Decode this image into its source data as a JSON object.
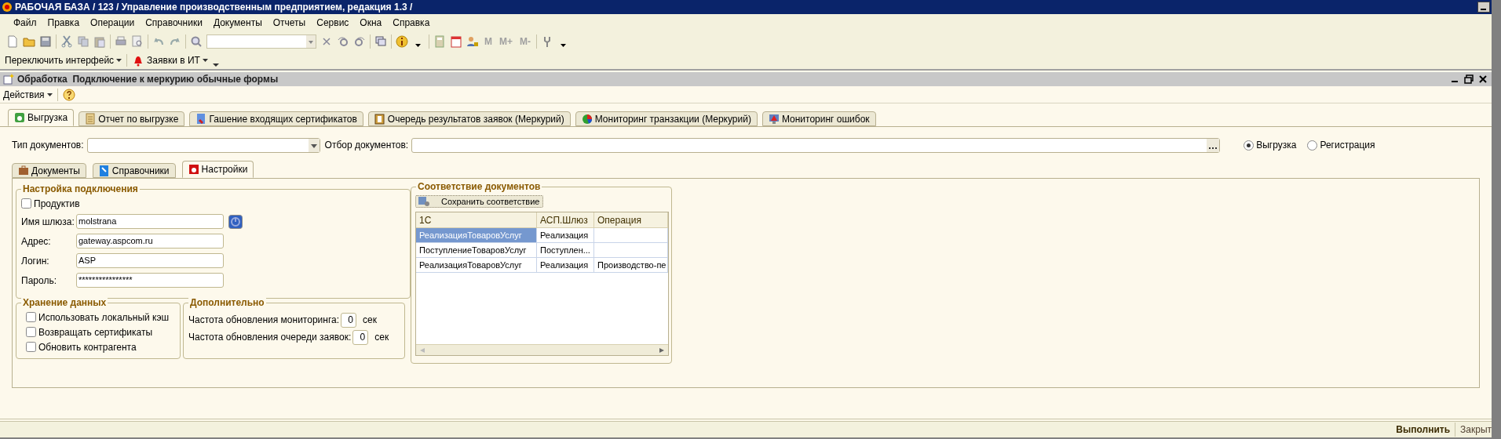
{
  "window": {
    "title": "РАБОЧАЯ БАЗА / 123 /  Управление производственным предприятием, редакция 1.3 /"
  },
  "menu": [
    "Файл",
    "Правка",
    "Операции",
    "Справочники",
    "Документы",
    "Отчеты",
    "Сервис",
    "Окна",
    "Справка"
  ],
  "toolbar": {
    "memory_buttons": [
      "M",
      "M+",
      "M-"
    ]
  },
  "toolbar2": {
    "items": [
      "Переключить интерфейс",
      "Заявки в ИТ"
    ]
  },
  "form": {
    "title": "Обработка  Подключение к меркурию обычные формы",
    "actions": "Действия",
    "tabs": [
      {
        "label": "Выгрузка",
        "selected": true
      },
      {
        "label": "Отчет по выгрузке",
        "selected": false
      },
      {
        "label": "Гашение входящих сертификатов",
        "selected": false
      },
      {
        "label": "Очередь результатов заявок (Меркурий)",
        "selected": false
      },
      {
        "label": "Мониторинг транзакции (Меркурий)",
        "selected": false
      },
      {
        "label": "Мониторинг ошибок",
        "selected": false
      }
    ],
    "doc_type_label": "Тип документов:",
    "doc_filter_label": "Отбор документов:",
    "mode": [
      {
        "label": "Выгрузка",
        "selected": true
      },
      {
        "label": "Регистрация",
        "selected": false
      }
    ],
    "subtabs": [
      {
        "label": "Документы",
        "selected": false
      },
      {
        "label": "Справочники",
        "selected": false
      },
      {
        "label": "Настройки",
        "selected": true
      }
    ],
    "connection": {
      "title": "Настройка подключения",
      "productive": {
        "label": "Продуктив",
        "checked": false
      },
      "fields": [
        {
          "label": "Имя шлюза:",
          "value": "molstrana"
        },
        {
          "label": "Адрес:",
          "value": "gateway.aspcom.ru"
        },
        {
          "label": "Логин:",
          "value": "ASP"
        },
        {
          "label": "Пароль:",
          "value": "****************"
        }
      ]
    },
    "storage": {
      "title": "Хранение данных",
      "options": [
        {
          "label": "Использовать локальный кэш",
          "checked": false
        },
        {
          "label": "Возвращать сертификаты",
          "checked": false
        },
        {
          "label": "Обновить контрагента",
          "checked": false
        }
      ]
    },
    "extra": {
      "title": "Дополнительно",
      "rows": [
        {
          "label": "Частота обновления мониторинга:",
          "value": "0",
          "unit": "сек"
        },
        {
          "label": "Частота обновления очереди заявок:",
          "value": "0",
          "unit": "сек"
        }
      ]
    },
    "mapping": {
      "title": "Соответствие документов",
      "save_button": "Сохранить соответствие",
      "columns": [
        "1С",
        "АСП.Шлюз",
        "Операция"
      ],
      "rows": [
        {
          "cells": [
            "РеализацияТоваровУслуг",
            "Реализация",
            ""
          ],
          "selected": true
        },
        {
          "cells": [
            "ПоступлениеТоваровУслуг",
            "Поступлен...",
            ""
          ],
          "selected": false
        },
        {
          "cells": [
            "РеализацияТоваровУслуг",
            "Реализация",
            "Производство-пе"
          ],
          "selected": false
        }
      ]
    },
    "footer": [
      {
        "label": "Выполнить",
        "kind": "default"
      },
      {
        "label": "Закрыт",
        "kind": "plain"
      }
    ]
  }
}
